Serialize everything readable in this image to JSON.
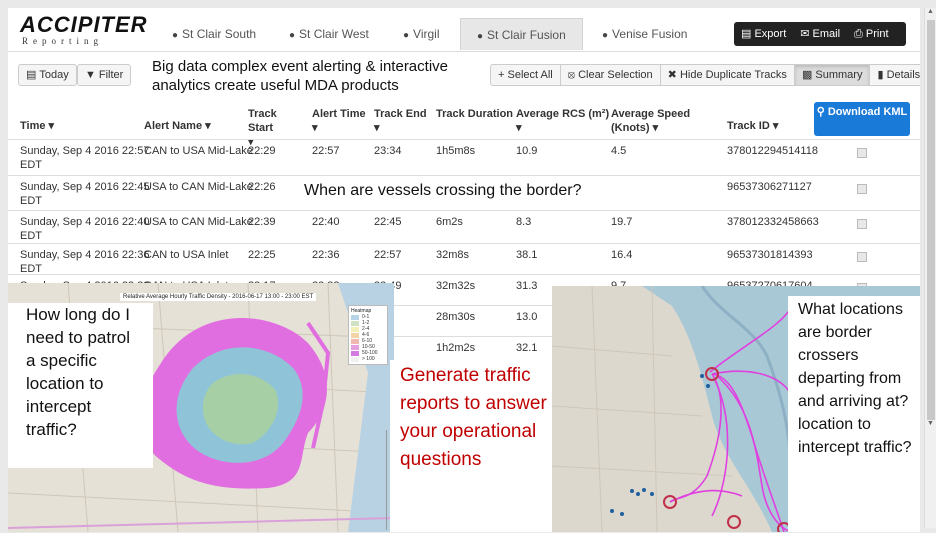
{
  "app": {
    "logo_main": "ACCIPITER",
    "logo_sub": "Reporting"
  },
  "tabs": [
    {
      "label": "St Clair South",
      "icon": "globe-icon"
    },
    {
      "label": "St Clair West",
      "icon": "globe-icon"
    },
    {
      "label": "Virgil",
      "icon": "globe-icon"
    },
    {
      "label": "St Clair Fusion",
      "icon": "globe-icon",
      "active": true
    },
    {
      "label": "Venise Fusion",
      "icon": "globe-icon"
    }
  ],
  "actions": {
    "export": "Export",
    "email": "Email",
    "print": "Print"
  },
  "toolbar": {
    "today": "Today",
    "filter": "Filter",
    "select_all": "Select All",
    "clear_selection": "Clear Selection",
    "hide_duplicates": "Hide Duplicate Tracks",
    "summary": "Summary",
    "details": "Details",
    "download_kml": "Download KML"
  },
  "captions": {
    "top": "Big data complex event alerting & interactive analytics create useful MDA products",
    "middle": "When are vessels crossing the border?",
    "left": "How long do I need to patrol a specific location to intercept traffic?",
    "center": "Generate traffic reports to answer your operational questions",
    "right": "What locations are border crossers departing from and arriving at? location to intercept traffic?"
  },
  "table": {
    "headers": [
      "Time",
      "Alert Name",
      "Track Start",
      "Alert Time",
      "Track End",
      "Track Duration",
      "Average RCS (m²)",
      "Average Speed (Knots)",
      "Track ID"
    ],
    "rows": [
      {
        "time": "Sunday, Sep 4 2016 22:57 EDT",
        "alert": "CAN to USA Mid-Lake",
        "start": "22:29",
        "alert_time": "22:57",
        "end": "23:34",
        "duration": "1h5m8s",
        "rcs": "10.9",
        "speed": "4.5",
        "track_id": "378012294514118"
      },
      {
        "time": "Sunday, Sep 4 2016 22:45 EDT",
        "alert": "USA to CAN Mid-Lake",
        "start": "22:26",
        "alert_time": "",
        "end": "",
        "duration": "",
        "rcs": "",
        "speed": "",
        "track_id": "96537306271127"
      },
      {
        "time": "Sunday, Sep 4 2016 22:40 EDT",
        "alert": "USA to CAN Mid-Lake",
        "start": "22:39",
        "alert_time": "22:40",
        "end": "22:45",
        "duration": "6m2s",
        "rcs": "8.3",
        "speed": "19.7",
        "track_id": "378012332458663"
      },
      {
        "time": "Sunday, Sep 4 2016 22:36 EDT",
        "alert": "CAN to USA Inlet",
        "start": "22:25",
        "alert_time": "22:36",
        "end": "22:57",
        "duration": "32m8s",
        "rcs": "38.1",
        "speed": "16.4",
        "track_id": "96537301814393"
      },
      {
        "time": "Sunday, Sep 4 2016 22:32 E",
        "alert": "CAN to USA Inlet",
        "start": "22:17",
        "alert_time": "22:32",
        "end": "22:49",
        "duration": "32m32s",
        "rcs": "31.3",
        "speed": "9.7",
        "track_id": "96537270617604"
      },
      {
        "time": "S",
        "alert": "",
        "start": "",
        "alert_time": "",
        "end": ":54",
        "duration": "28m30s",
        "rcs": "13.0",
        "speed": "",
        "track_id": ""
      },
      {
        "time": "S",
        "alert": "",
        "start": "",
        "alert_time": "",
        "end": ":12",
        "duration": "1h2m2s",
        "rcs": "32.1",
        "speed": "",
        "track_id": ""
      },
      {
        "time": "S",
        "alert": "",
        "start": "",
        "alert_time": "",
        "end": "",
        "duration": "",
        "rcs": "",
        "speed": "",
        "track_id": ""
      },
      {
        "time": "S",
        "alert": "",
        "start": "",
        "alert_time": "",
        "end": "",
        "duration": "",
        "rcs": "",
        "speed": "",
        "track_id": ""
      }
    ]
  },
  "heatmap": {
    "title": "Relative Average Hourly Traffic Density - 2016-06-17 13:00 - 23:00 EST",
    "legend_title": "Heatmap",
    "legend": [
      {
        "label": "0-1",
        "color": "#b7d3e6"
      },
      {
        "label": "1-2",
        "color": "#cfe2c4"
      },
      {
        "label": "2-4",
        "color": "#f2f0b6"
      },
      {
        "label": "4-6",
        "color": "#f3d4a8"
      },
      {
        "label": "6-10",
        "color": "#f0b8b0"
      },
      {
        "label": "10-50",
        "color": "#e6a0e0"
      },
      {
        "label": "50-100",
        "color": "#d27ae0"
      },
      {
        "label": "> 100",
        "color": "#f0f0f0"
      }
    ]
  },
  "colors": {
    "accent": "#1a7ad8",
    "caption_red": "#c00000",
    "track_magenta": "#e040e0"
  }
}
